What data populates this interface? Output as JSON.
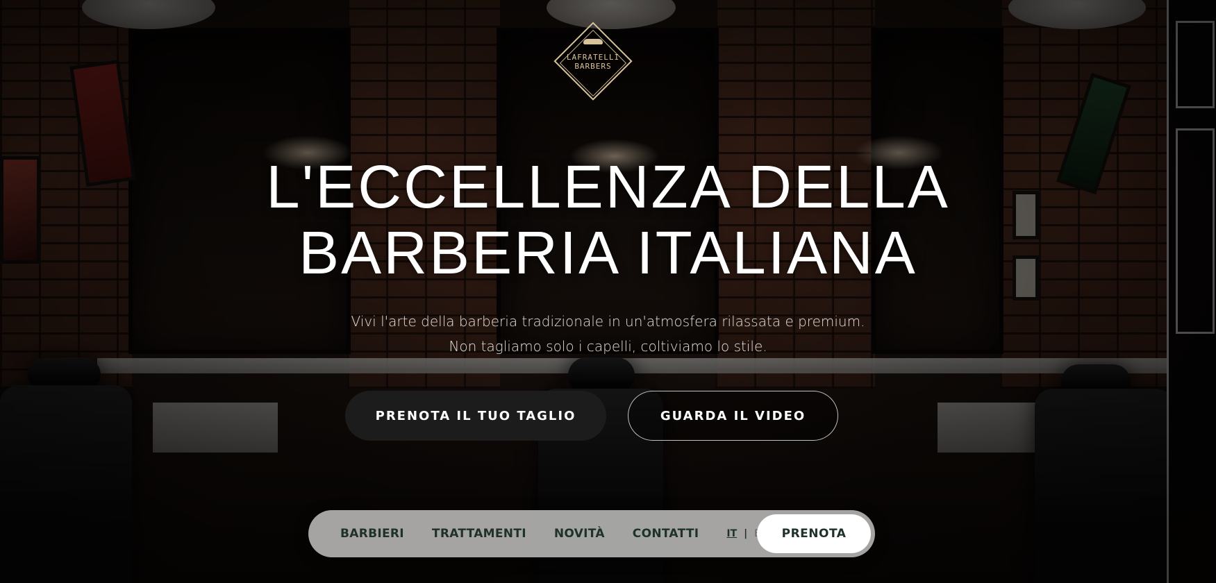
{
  "logo": {
    "line1": "Lafratelli",
    "line2": "Barbers"
  },
  "hero": {
    "headline_line1": "L'ECCELLENZA DELLA",
    "headline_line2": "BARBERIA ITALIANA",
    "subtitle_line1": "Vivi l'arte della barberia tradizionale in un'atmosfera rilassata e premium.",
    "subtitle_line2": "Non tagliamo solo i capelli, coltiviamo lo stile.",
    "primary_cta": "PRENOTA IL TUO TAGLIO",
    "secondary_cta": "GUARDA IL VIDEO"
  },
  "nav": {
    "items": [
      "BARBIERI",
      "TRATTAMENTI",
      "NOVITÀ",
      "CONTATTI"
    ],
    "lang_active": "IT",
    "lang_separator": "|",
    "lang_other": "EN",
    "cta": "PRENOTA"
  },
  "colors": {
    "nav_text": "#1e3227",
    "gold_accent": "#d8c49a",
    "primary_button": "#1c1c1c"
  },
  "icons": {
    "logo": "mustache-diamond-logo-icon"
  }
}
